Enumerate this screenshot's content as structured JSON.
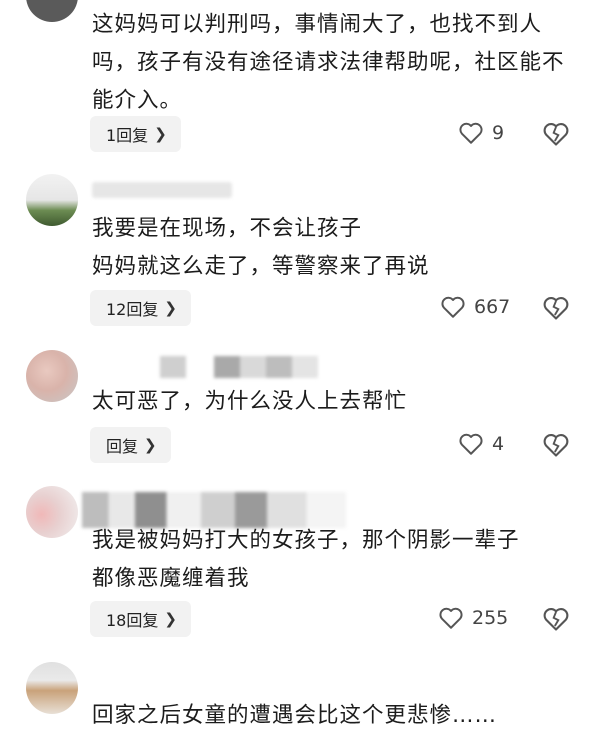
{
  "comments": [
    {
      "text": "这妈妈可以判刑吗，事情闹大了，也找不到人吗，孩子有没有途径请求法律帮助呢，社区能不能介入。",
      "reply_label": "1回复",
      "likes": "9"
    },
    {
      "text": "我要是在现场，不会让孩子妈妈就这么走了，等警察来了再说",
      "line1": "我要是在现场，不会让孩子",
      "line2": "妈妈就这么走了，等警察来了再说",
      "reply_label": "12回复",
      "likes": "667"
    },
    {
      "text": "太可恶了，为什么没人上去帮忙",
      "reply_label": "回复",
      "likes": "4"
    },
    {
      "text": "我是被妈妈打大的女孩子，那个阴影一辈子都像恶魔缠着我",
      "line1": "我是被妈妈打大的女孩子，那个阴影一辈子",
      "line2": "都像恶魔缠着我",
      "reply_label": "18回复",
      "likes": "255"
    },
    {
      "text": "回家之后女童的遭遇会比这个更悲惨……"
    }
  ],
  "icons": {
    "like": "heart-outline-icon",
    "dislike": "broken-heart-icon",
    "reply_arrow": "chevron-right-icon"
  },
  "colors": {
    "text": "#1c1c1c",
    "reply_bg": "#f2f2f2",
    "icon": "#555555"
  }
}
